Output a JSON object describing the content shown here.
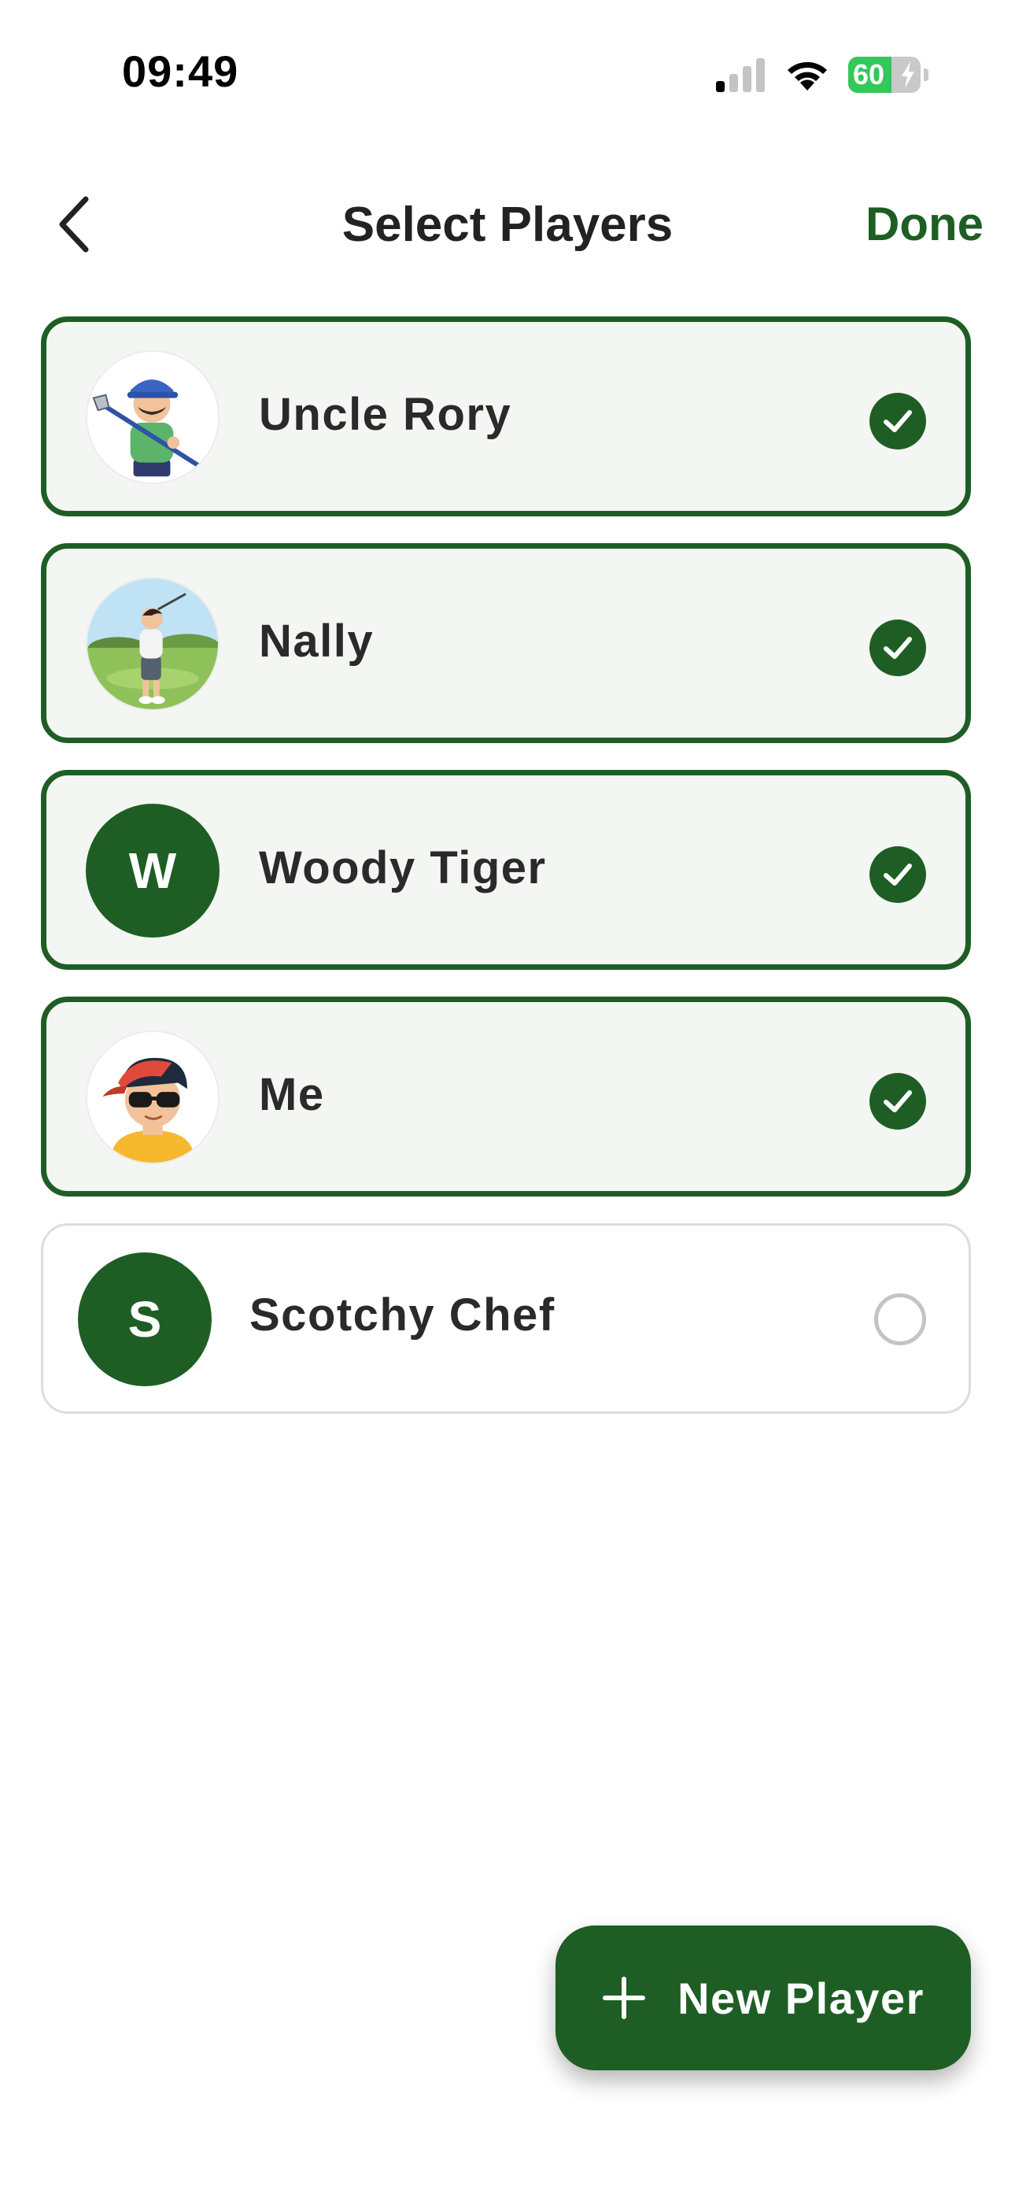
{
  "status_bar": {
    "time": "09:49",
    "battery_percent": 60,
    "battery_label": "60",
    "icons": [
      "signal-icon",
      "wifi-icon",
      "battery-icon"
    ]
  },
  "header": {
    "back_icon": "chevron-left-icon",
    "title": "Select Players",
    "done_label": "Done"
  },
  "players": [
    {
      "name": "Uncle Rory",
      "avatar": "golfer-cartoon-avatar",
      "selected": true
    },
    {
      "name": "Nally",
      "avatar": "golfer-course-avatar",
      "selected": true
    },
    {
      "name": "Woody Tiger",
      "initial": "W",
      "selected": true
    },
    {
      "name": "Me",
      "avatar": "sunglasses-cap-avatar",
      "selected": true
    },
    {
      "name": "Scotchy Chef",
      "initial": "S",
      "selected": false
    }
  ],
  "fab": {
    "label": "New Player",
    "icon": "plus-icon"
  },
  "colors": {
    "accent": "#1e5e24",
    "card_selected_bg": "#f4f6f3",
    "card_unselected_border": "#dddddd",
    "battery_green": "#34c759"
  }
}
